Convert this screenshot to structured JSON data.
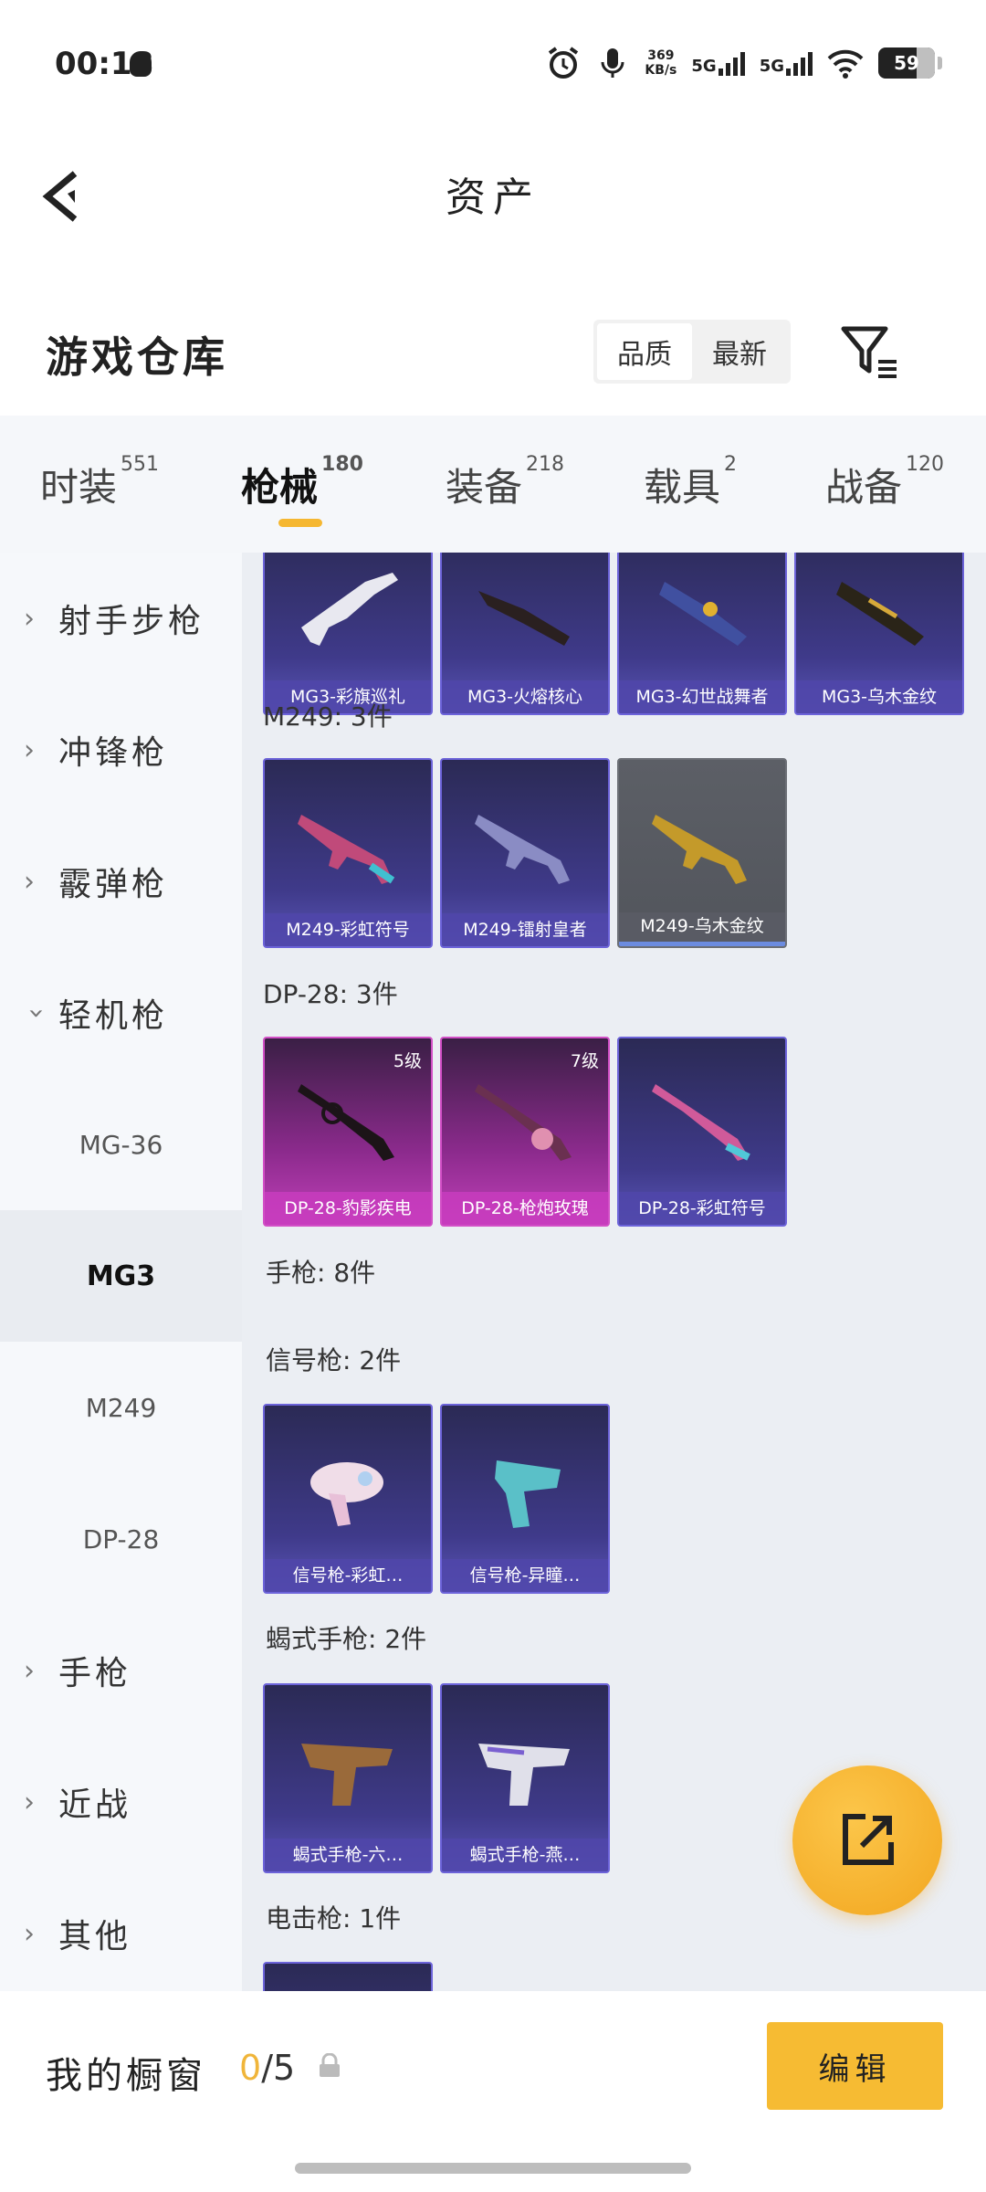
{
  "status": {
    "time": "00:18",
    "speed_value": "369",
    "speed_unit": "KB/s",
    "net1": "5G",
    "net2": "5G",
    "battery": "59"
  },
  "header": {
    "title": "资产"
  },
  "warehouse": {
    "title": "游戏仓库",
    "sort_quality": "品质",
    "sort_newest": "最新"
  },
  "tabs": [
    {
      "label": "时装",
      "count": "551"
    },
    {
      "label": "枪械",
      "count": "180"
    },
    {
      "label": "装备",
      "count": "218"
    },
    {
      "label": "载具",
      "count": "2"
    },
    {
      "label": "战备",
      "count": "120"
    }
  ],
  "sidebar": {
    "sniper": "射手步枪",
    "smg": "冲锋枪",
    "shotgun": "霰弹枪",
    "lmg": "轻机枪",
    "sub": [
      "MG-36",
      "MG3",
      "M249",
      "DP-28"
    ],
    "pistol": "手枪",
    "melee": "近战",
    "other": "其他"
  },
  "content": {
    "mg3_cards": [
      "MG3-彩旗巡礼",
      "MG3-火熔核心",
      "MG3-幻世战舞者",
      "MG3-乌木金纹"
    ],
    "m249_label": "M249: 3件",
    "m249_cards": [
      "M249-彩虹符号",
      "M249-镭射皇者",
      "M249-乌木金纹"
    ],
    "dp28_label": "DP-28: 3件",
    "dp28_cards": [
      "DP-28-豹影疾电",
      "DP-28-枪炮玫瑰",
      "DP-28-彩虹符号"
    ],
    "dp28_levels": [
      "5级",
      "7级"
    ],
    "pistol_label": "手枪: 8件",
    "flare_label": "信号枪: 2件",
    "flare_cards": [
      "信号枪-彩虹…",
      "信号枪-异瞳…"
    ],
    "scorpion_label": "蝎式手枪: 2件",
    "scorpion_cards": [
      "蝎式手枪-六…",
      "蝎式手枪-燕…"
    ],
    "taser_label": "电击枪: 1件"
  },
  "bottom": {
    "showcase": "我的橱窗",
    "used": "0",
    "total": "/5",
    "edit": "编辑"
  },
  "colors": {
    "accent": "#f5b731",
    "card_purple": "#3f3a8a",
    "card_pink": "#c040b8",
    "card_gray": "#5c5f66"
  }
}
